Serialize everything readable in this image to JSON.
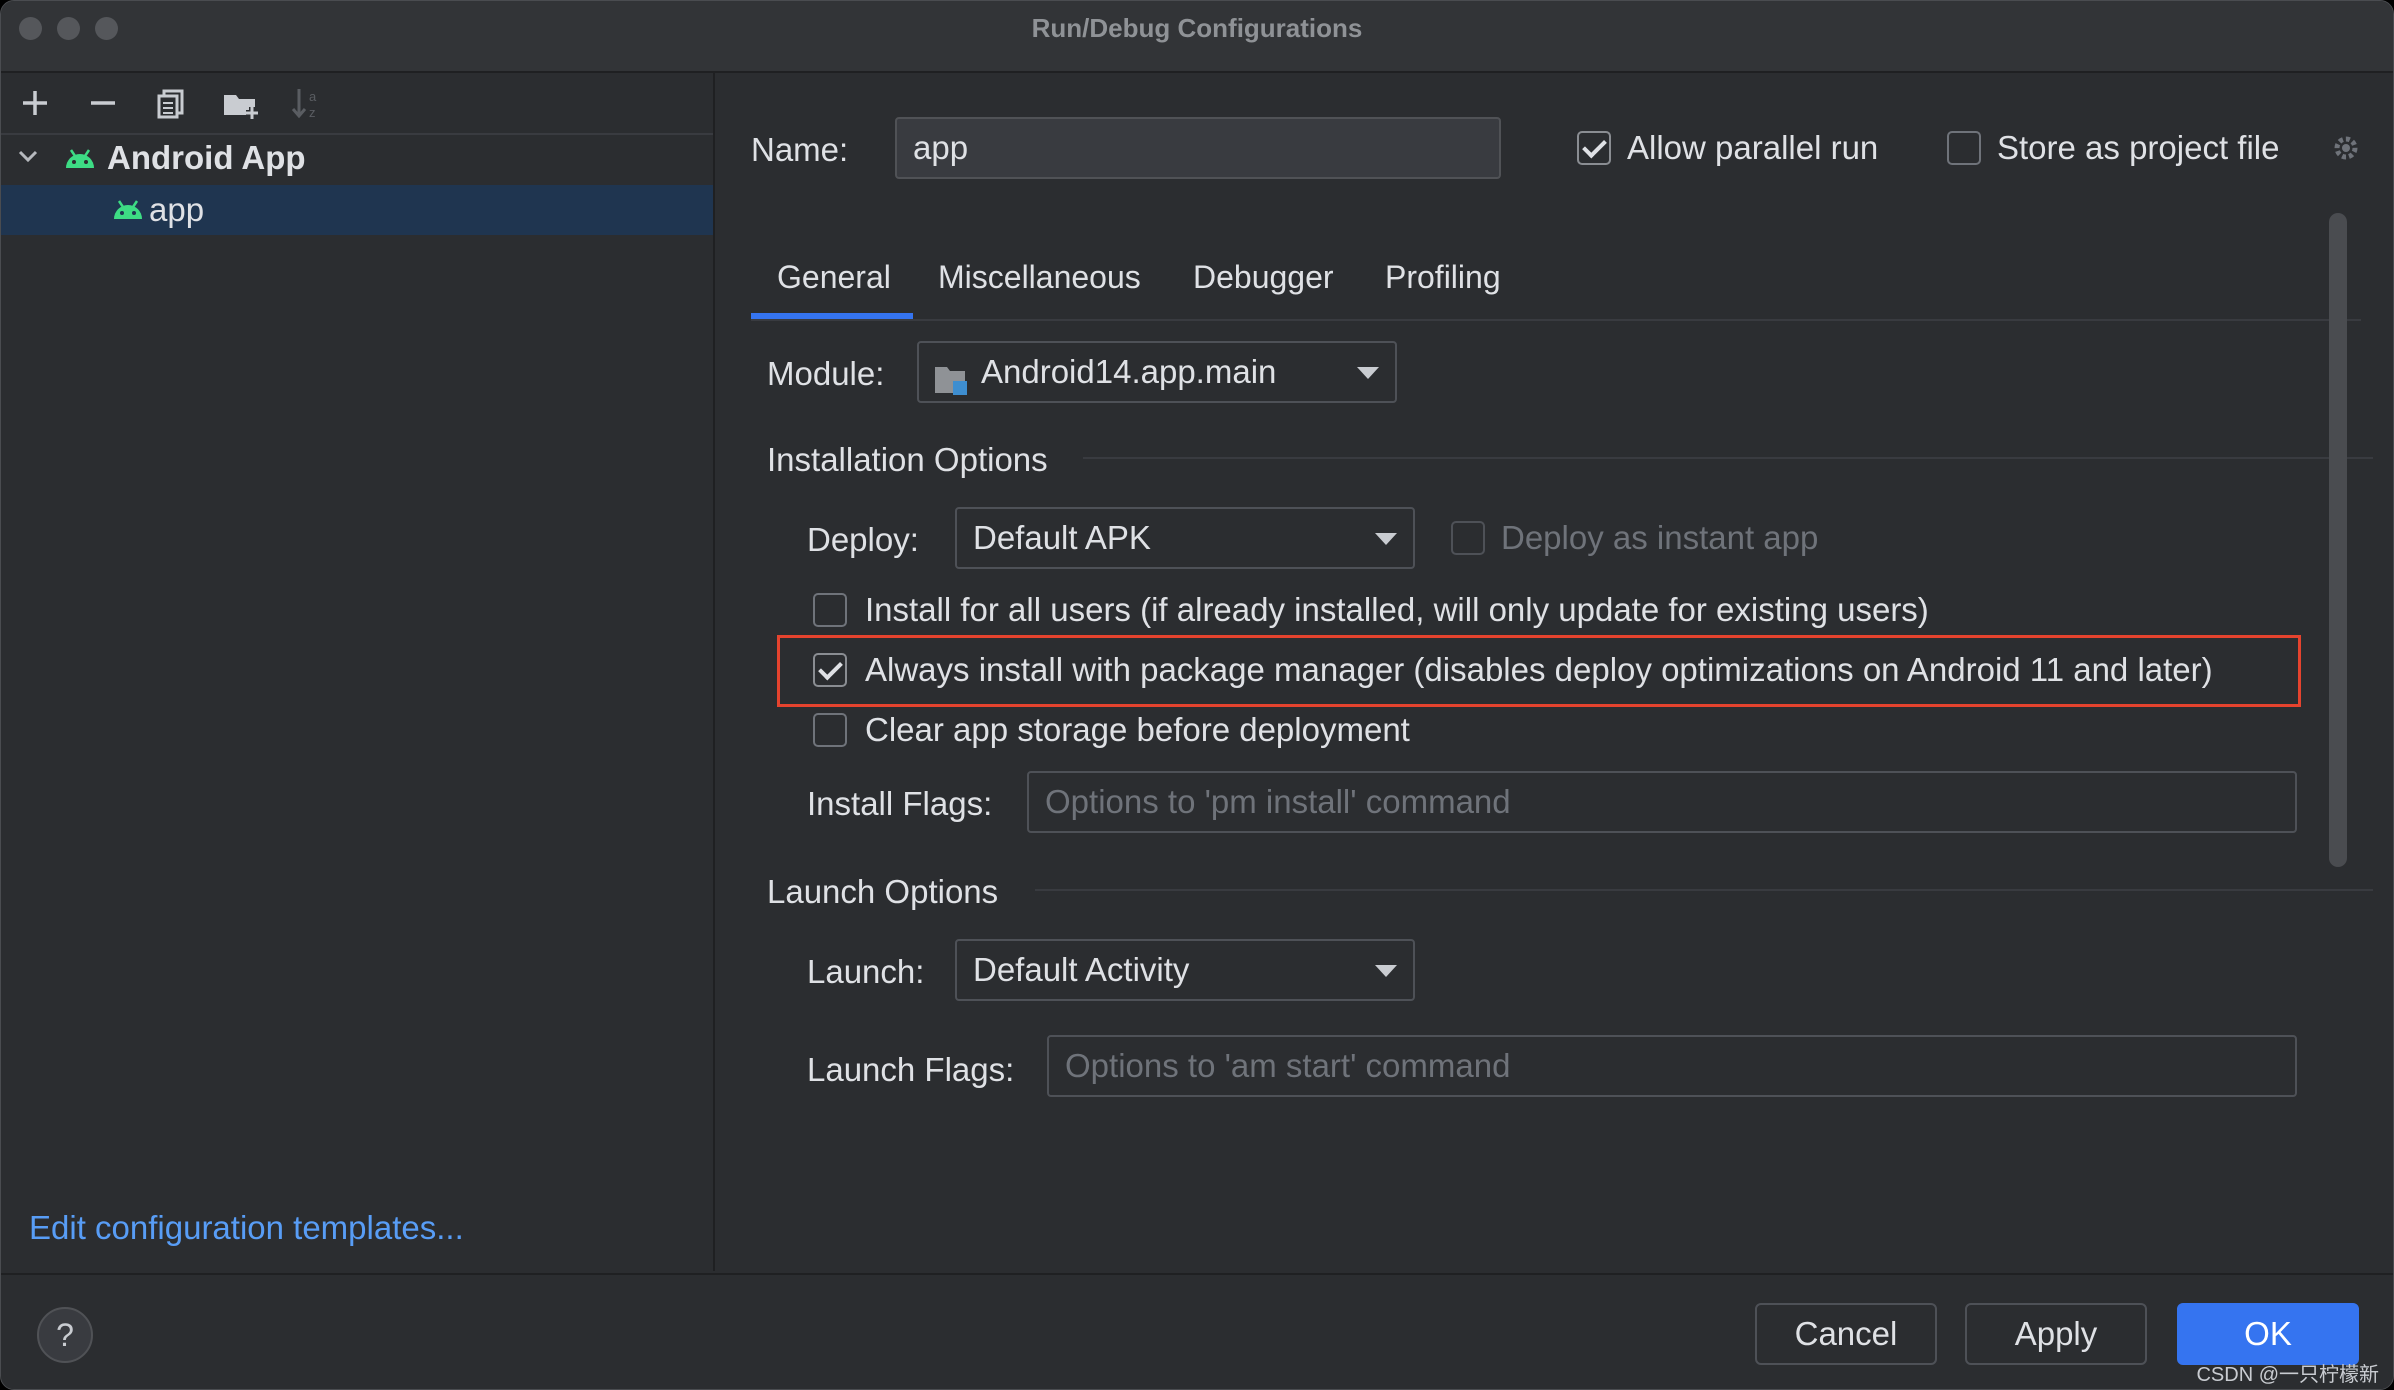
{
  "window": {
    "title": "Run/Debug Configurations"
  },
  "toolbar": {
    "icons": [
      "add-icon",
      "remove-icon",
      "copy-icon",
      "new-folder-icon",
      "sort-icon"
    ]
  },
  "tree": {
    "group_label": "Android App",
    "item_label": "app"
  },
  "sidebar": {
    "templates_link": "Edit configuration templates..."
  },
  "header": {
    "name_label": "Name:",
    "name_value": "app",
    "allow_parallel_label": "Allow parallel run",
    "allow_parallel_checked": true,
    "store_project_label": "Store as project file",
    "store_project_checked": false
  },
  "tabs": [
    {
      "label": "General",
      "active": true
    },
    {
      "label": "Miscellaneous",
      "active": false
    },
    {
      "label": "Debugger",
      "active": false
    },
    {
      "label": "Profiling",
      "active": false
    }
  ],
  "module": {
    "label": "Module:",
    "value": "Android14.app.main"
  },
  "installation": {
    "section_title": "Installation Options",
    "deploy_label": "Deploy:",
    "deploy_value": "Default APK",
    "instant_app_label": "Deploy as instant app",
    "install_all_users_label": "Install for all users (if already installed, will only update for existing users)",
    "always_install_pm_label": "Always install with package manager (disables deploy optimizations on Android 11 and later)",
    "always_install_pm_checked": true,
    "clear_storage_label": "Clear app storage before deployment",
    "install_flags_label": "Install Flags:",
    "install_flags_placeholder": "Options to 'pm install' command"
  },
  "launch": {
    "section_title": "Launch Options",
    "launch_label": "Launch:",
    "launch_value": "Default Activity",
    "launch_flags_label": "Launch Flags:",
    "launch_flags_placeholder": "Options to 'am start' command"
  },
  "buttons": {
    "help": "?",
    "cancel": "Cancel",
    "apply": "Apply",
    "ok": "OK"
  },
  "watermark": "CSDN @一只柠檬新",
  "colors": {
    "accent": "#3574f0",
    "link": "#589df6",
    "highlight_border": "#e5432e",
    "android_green": "#3ddc84"
  }
}
